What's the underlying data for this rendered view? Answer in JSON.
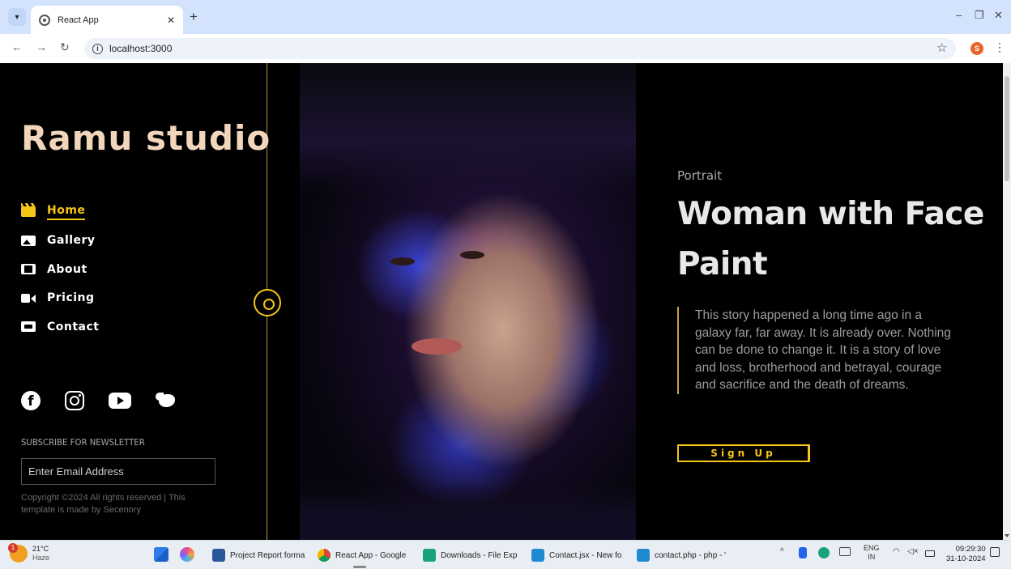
{
  "browser": {
    "tab_title": "React App",
    "url": "localhost:3000",
    "profile_initial": "S"
  },
  "sidebar": {
    "logo": "Ramu studio",
    "nav": [
      {
        "label": "Home",
        "icon": "clapperboard-icon",
        "active": true
      },
      {
        "label": "Gallery",
        "icon": "image-icon",
        "active": false
      },
      {
        "label": "About",
        "icon": "film-icon",
        "active": false
      },
      {
        "label": "Pricing",
        "icon": "video-camera-icon",
        "active": false
      },
      {
        "label": "Contact",
        "icon": "camera-icon",
        "active": false
      }
    ],
    "social": [
      "facebook-icon",
      "instagram-icon",
      "youtube-icon",
      "twitter-icon"
    ],
    "newsletter_title": "SUBSCRIBE FOR NEWSLETTER",
    "email_placeholder": "Enter Email Address",
    "copyright": "Copyright ©2024 All rights reserved | This template is made by Secenory"
  },
  "hero": {
    "subtitle": "Portrait",
    "title": "Woman with Face Paint",
    "story": "This story happened a long time ago in a galaxy far, far away. It is already over. Nothing can be done to change it. It is a story of love and loss, brotherhood and betrayal, courage and sacrifice and the death of dreams.",
    "cta": "Sign Up"
  },
  "colors": {
    "accent": "#f5c518",
    "background": "#000000",
    "logo": "#f2d6bc"
  },
  "taskbar": {
    "weather_temp": "21°C",
    "weather_desc": "Haze",
    "apps": [
      "Project Report forma",
      "React App - Google",
      "Downloads - File Exp",
      "Contact.jsx - New fo",
      "contact.php - php - '"
    ],
    "lang_top": "ENG",
    "lang_bottom": "IN",
    "time": "09:29:30",
    "date": "31-10-2024"
  }
}
